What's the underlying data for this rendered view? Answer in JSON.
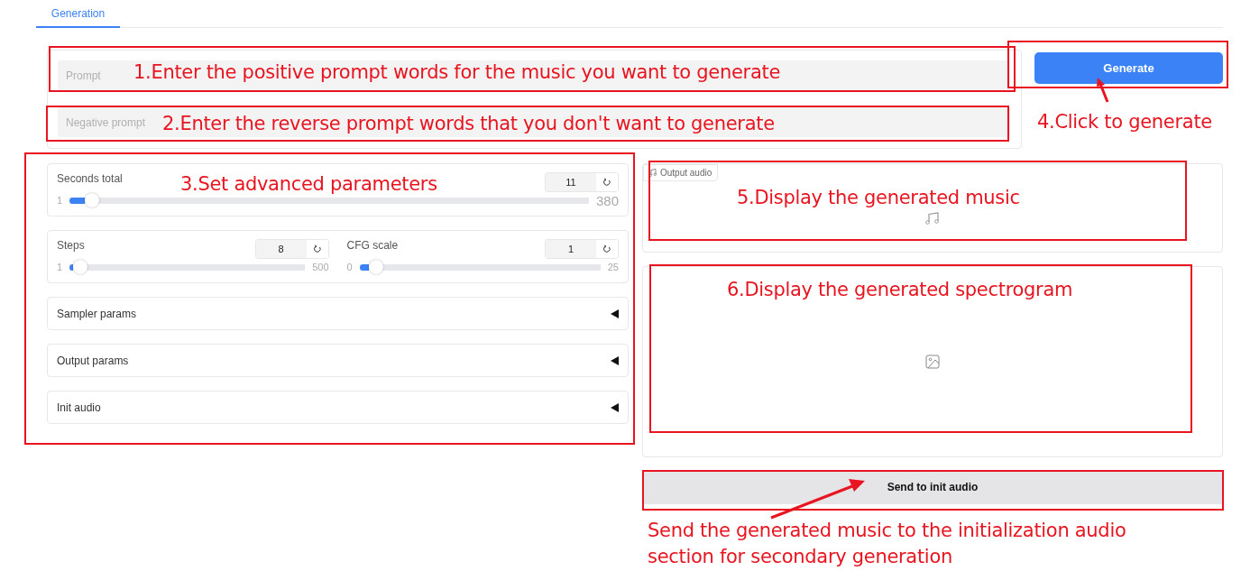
{
  "tabs": [
    {
      "label": "Generation",
      "selected": true
    }
  ],
  "prompt": {
    "placeholder": "Prompt"
  },
  "negative_prompt": {
    "placeholder": "Negative prompt"
  },
  "generate_button": "Generate",
  "slider_rows": [
    [
      {
        "label": "Seconds total",
        "value": "11",
        "min": "1",
        "max": "380",
        "level": 0.03
      }
    ],
    [
      {
        "label": "Steps",
        "value": "8",
        "min": "1",
        "max": "500",
        "level": 0.014
      },
      {
        "label": "CFG scale",
        "value": "1",
        "min": "0",
        "max": "25",
        "level": 0.04
      }
    ]
  ],
  "accordions": [
    {
      "label": "Sampler params",
      "expanded": false
    },
    {
      "label": "Output params",
      "expanded": false
    },
    {
      "label": "Init audio",
      "expanded": false
    }
  ],
  "output_audio": {
    "label": "Output audio"
  },
  "send_button": "Send to init audio",
  "annotations": [
    {
      "text": "1.Enter the positive prompt words for the music you want to generate"
    },
    {
      "text": "2.Enter the reverse prompt words that you don't want to generate"
    },
    {
      "text": "3.Set advanced parameters"
    },
    {
      "text": "4.Click to generate"
    },
    {
      "text": "5.Display the generated music"
    },
    {
      "text": "6.Display the generated spectrogram"
    },
    {
      "text": "Send the generated music to the initialization audio section for secondary generation"
    }
  ]
}
